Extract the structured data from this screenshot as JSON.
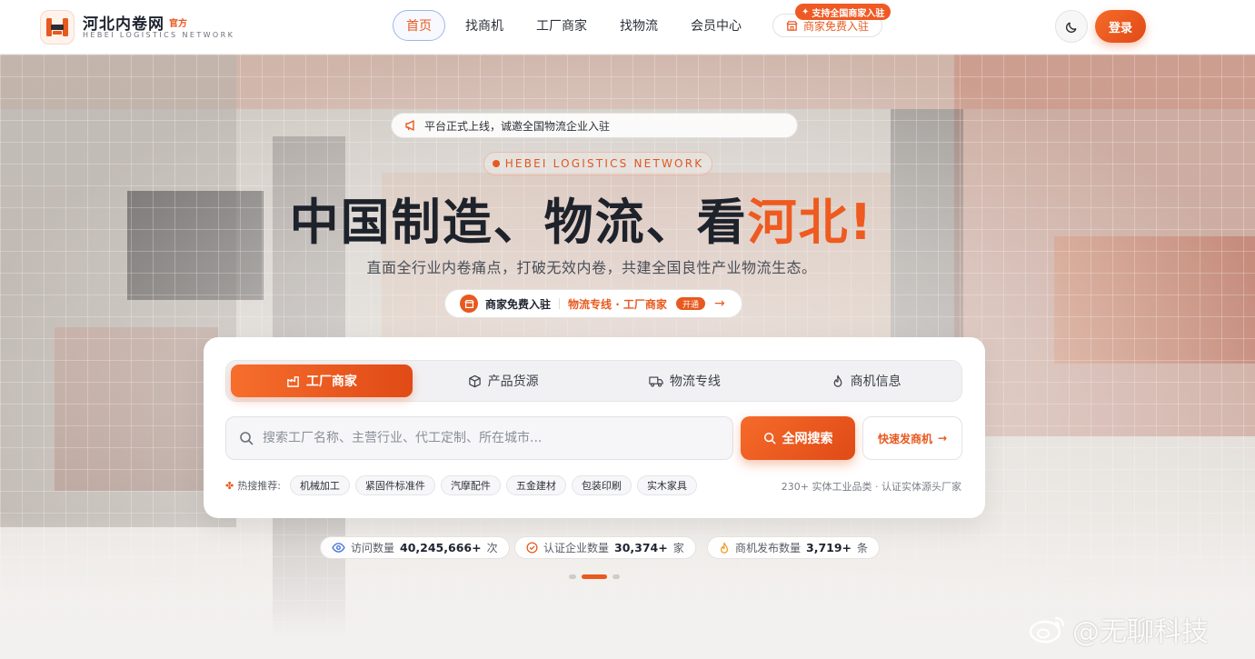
{
  "header": {
    "brand_name": "河北内卷网",
    "brand_tag": "官方",
    "brand_sub": "HEBEI LOGISTICS NETWORK",
    "nav": [
      {
        "label": "首页",
        "active": true
      },
      {
        "label": "找商机",
        "active": false
      },
      {
        "label": "工厂商家",
        "active": false
      },
      {
        "label": "找物流",
        "active": false
      },
      {
        "label": "会员中心",
        "active": false
      }
    ],
    "merchant_label": "商家免费入驻",
    "merchant_badge": "支持全国商家入驻",
    "login_label": "登录",
    "theme_icon": "moon-icon"
  },
  "hero": {
    "notice": "平台正式上线，诚邀全国物流企业入驻",
    "en_tagline": "HEBEI LOGISTICS NETWORK",
    "headline_main": "中国制造、物流、看",
    "headline_highlight": "河北!",
    "subline": "直面全行业内卷痛点，打破无效内卷，共建全国良性产业物流生态。",
    "cta": {
      "primary": "商家免费入驻",
      "secondary": "物流专线 · 工厂商家",
      "badge": "开通"
    }
  },
  "search": {
    "tabs": [
      {
        "label": "工厂商家",
        "icon": "factory-icon",
        "active": true
      },
      {
        "label": "产品货源",
        "icon": "box-icon",
        "active": false
      },
      {
        "label": "物流专线",
        "icon": "truck-icon",
        "active": false
      },
      {
        "label": "商机信息",
        "icon": "flame-icon",
        "active": false
      }
    ],
    "placeholder": "搜索工厂名称、主营行业、代工定制、所在城市...",
    "search_label": "全网搜索",
    "quick_label": "快速发商机",
    "hot_label": "热搜推荐:",
    "hot_tags": [
      "机械加工",
      "紧固件标准件",
      "汽摩配件",
      "五金建材",
      "包装印刷",
      "实木家具"
    ],
    "hot_note": "230+ 实体工业品类 · 认证实体源头厂家"
  },
  "stats": [
    {
      "label": "访问数量",
      "value": "40,245,666+",
      "unit": "次",
      "icon": "eye-icon"
    },
    {
      "label": "认证企业数量",
      "value": "30,374+",
      "unit": "家",
      "icon": "check-badge-icon"
    },
    {
      "label": "商机发布数量",
      "value": "3,719+",
      "unit": "条",
      "icon": "flame-icon"
    }
  ],
  "carousel": {
    "count": 3,
    "active_index": 1
  },
  "watermark": "@无聊科技",
  "colors": {
    "accent": "#e8591f",
    "text": "#1f2430"
  }
}
